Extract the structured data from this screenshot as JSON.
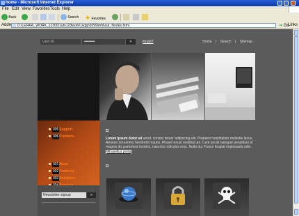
{
  "window": {
    "title": "home - Microsoft Internet Explorer"
  },
  "menubar": {
    "items": [
      "File",
      "Edit",
      "View",
      "Favorites",
      "Tools",
      "Help"
    ]
  },
  "toolbar": {
    "back_label": "Back",
    "search_label": "Search",
    "favorites_label": "Favorites"
  },
  "address": {
    "label": "Address",
    "url": "D:\\LEFAR\\_WORK_12300\\1ub\\12(fwork\\1ixgp\\5099\\mhl\\out..f\\index.html",
    "go_label": "Go",
    "links_label": "Links"
  },
  "site": {
    "login": {
      "user_placeholder": "User ID",
      "password_mask": "••••••••••••",
      "go_symbol": "»",
      "forgot_label": "forgot?"
    },
    "topnav": [
      "Home",
      "Search",
      "Sitemap"
    ],
    "topnav_separator": "|",
    "menu": [
      {
        "num": "001",
        "label": "News"
      },
      {
        "num": "002",
        "label": "Products"
      },
      {
        "num": "003",
        "label": "Solutions"
      },
      {
        "num": "004",
        "label": "Services"
      },
      {
        "num": "005",
        "label": "Support"
      },
      {
        "num": "006",
        "label": "Contacts"
      }
    ],
    "newsletter": {
      "placeholder": "Newsletter signup",
      "go_symbol": "»"
    },
    "content": {
      "lead": "Lorem ipsum dolor sit",
      "body": " amet, consec tetuer adipiscing elit. Praesent vestibulum molestie lacus. Aenean nonummy hendrerit mauris. Phasel eousl vestibul um. Cum sociis natoque penatibus et magnis dis parturient montes, nascetur ridiculus mus. Nulla dui. Fusce feugiat malesuada odio.",
      "more_link": "Mhasellus porta"
    },
    "cards": [
      {
        "icon": "globe-icon"
      },
      {
        "icon": "padlock-icon"
      },
      {
        "icon": "skull-icon"
      }
    ]
  },
  "colors": {
    "page_bg": "#5b5b5b",
    "accent_orange": "#c4561b",
    "menu_label_orange": "#ff7a1a"
  }
}
